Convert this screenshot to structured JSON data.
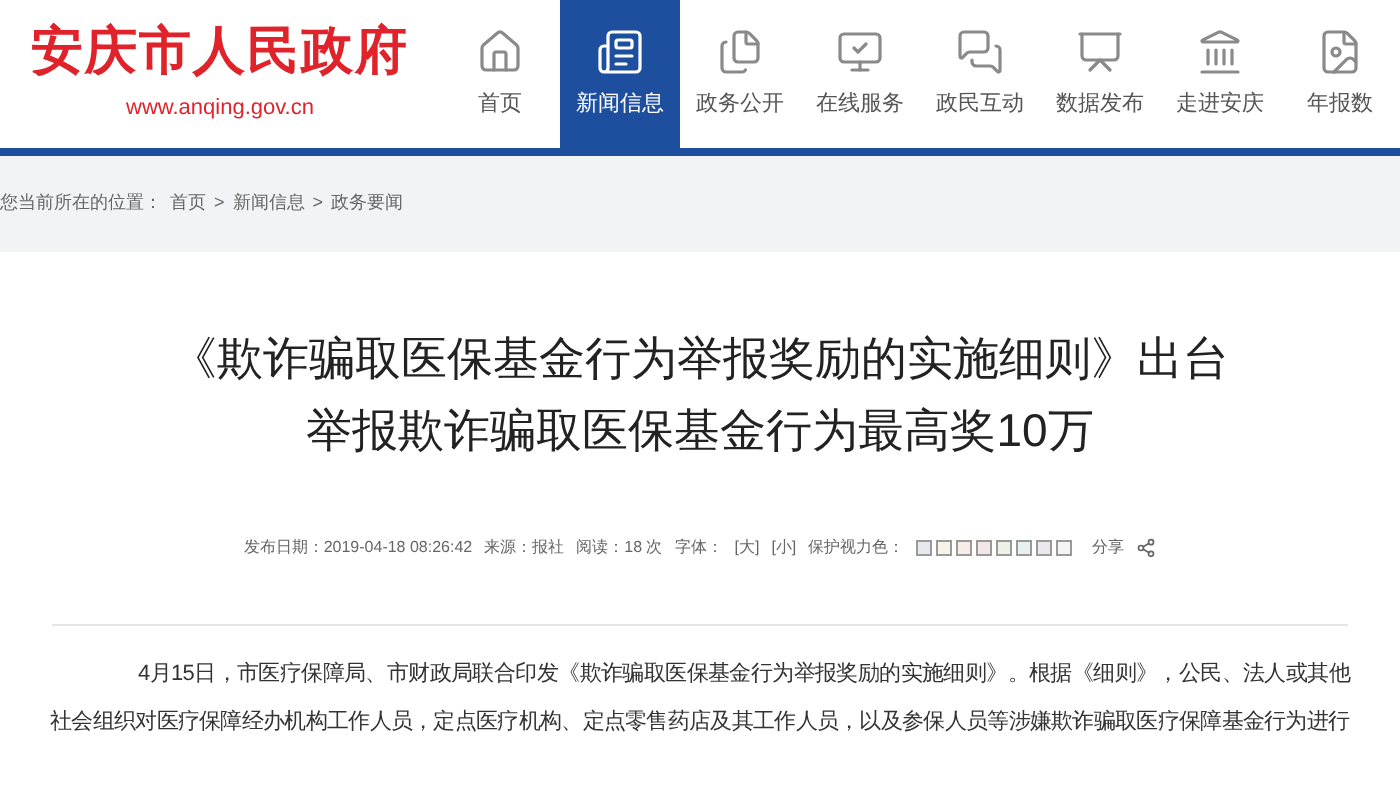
{
  "site": {
    "title": "安庆市人民政府",
    "url": "www.anqing.gov.cn"
  },
  "nav": [
    {
      "label": "首页",
      "kind": "home",
      "selected": false
    },
    {
      "label": "新闻信息",
      "kind": "news",
      "selected": true
    },
    {
      "label": "政务公开",
      "kind": "files",
      "selected": false
    },
    {
      "label": "在线服务",
      "kind": "monitor",
      "selected": false
    },
    {
      "label": "政民互动",
      "kind": "chat",
      "selected": false
    },
    {
      "label": "数据发布",
      "kind": "chart",
      "selected": false
    },
    {
      "label": "走进安庆",
      "kind": "tower",
      "selected": false
    },
    {
      "label": "年报数",
      "kind": "report",
      "selected": false
    }
  ],
  "breadcrumb": {
    "prefix": "您当前所在的位置：",
    "items": [
      "首页",
      "新闻信息",
      "政务要闻"
    ],
    "separator": ">"
  },
  "article": {
    "title_lines": [
      "《欺诈骗取医保基金行为举报奖励的实施细则》出台",
      "举报欺诈骗取医保基金行为最高奖10万"
    ],
    "meta": {
      "date": "发布日期：2019-04-18 08:26:42",
      "source": "来源：报社",
      "reads": "阅读：18 次",
      "font_label": "字体：",
      "font_large": "[大]",
      "font_small": "[小]",
      "eye_label": "保护视力色：",
      "swatches": [
        {
          "color": "#e8e8ef"
        },
        {
          "color": "#f7f3e6"
        },
        {
          "color": "#f6ece8"
        },
        {
          "color": "#f2e9e6"
        },
        {
          "color": "#ecf2e6"
        },
        {
          "color": "#e6f2f0"
        },
        {
          "color": "#ece8f0"
        },
        {
          "color": "#f4f4f4"
        }
      ],
      "share": "分享"
    },
    "paragraph": "4月15日，市医疗保障局、市财政局联合印发《欺诈骗取医保基金行为举报奖励的实施细则》。根据《细则》，公民、法人或其他社会组织对医疗保障经办机构工作人员，定点医疗机构、定点零售药店及其工作人员，以及参保人员等涉嫌欺诈骗取医疗保障基金行为进行"
  }
}
